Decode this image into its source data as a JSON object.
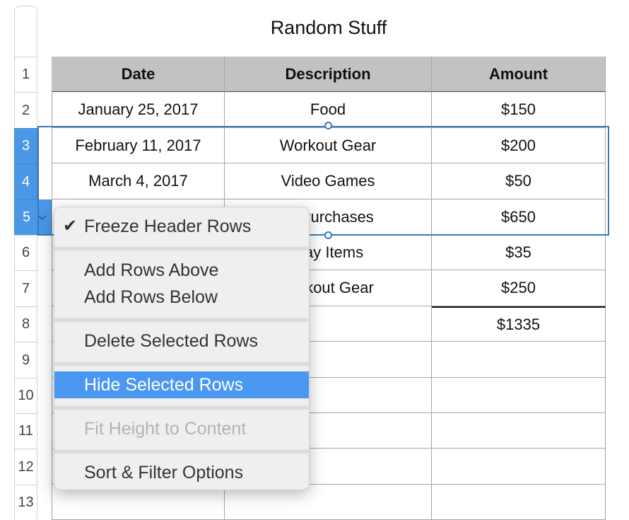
{
  "sheet": {
    "title": "Random Stuff",
    "row_numbers": [
      "1",
      "2",
      "3",
      "4",
      "5",
      "6",
      "7",
      "8",
      "9",
      "10",
      "11",
      "12",
      "13"
    ],
    "selected_rows": [
      "3",
      "4",
      "5"
    ],
    "columns": [
      "Date",
      "Description",
      "Amount"
    ],
    "rows": [
      [
        "January 25, 2017",
        "Food",
        "$150"
      ],
      [
        "February 11, 2017",
        "Workout Gear",
        "$200"
      ],
      [
        "March 4, 2017",
        "Video Games",
        "$50"
      ],
      [
        "",
        "re Purchases",
        "$650"
      ],
      [
        "",
        "play Items",
        "$35"
      ],
      [
        "",
        "Vorkout Gear",
        "$250"
      ],
      [
        "",
        "",
        "$1335"
      ],
      [
        "",
        "",
        ""
      ],
      [
        "",
        "",
        ""
      ],
      [
        "",
        "",
        ""
      ],
      [
        "",
        "",
        ""
      ],
      [
        "",
        "",
        ""
      ]
    ],
    "total_label": "$1335"
  },
  "menu": {
    "items": [
      {
        "label": "Freeze Header Rows",
        "checked": true,
        "state": "enabled"
      },
      {
        "label": "Add Rows Above",
        "state": "enabled"
      },
      {
        "label": "Add Rows Below",
        "state": "enabled"
      },
      {
        "label": "Delete Selected Rows",
        "state": "enabled"
      },
      {
        "label": "Hide Selected Rows",
        "state": "highlighted"
      },
      {
        "label": "Fit Height to Content",
        "state": "disabled"
      },
      {
        "label": "Sort & Filter Options",
        "state": "enabled"
      }
    ],
    "check_glyph": "✔",
    "highlight_color": "#4a97f2"
  },
  "colors": {
    "selection": "#3a79b8",
    "row_header_selected": "#4a97e6",
    "header_fill": "#c1c2c2"
  }
}
